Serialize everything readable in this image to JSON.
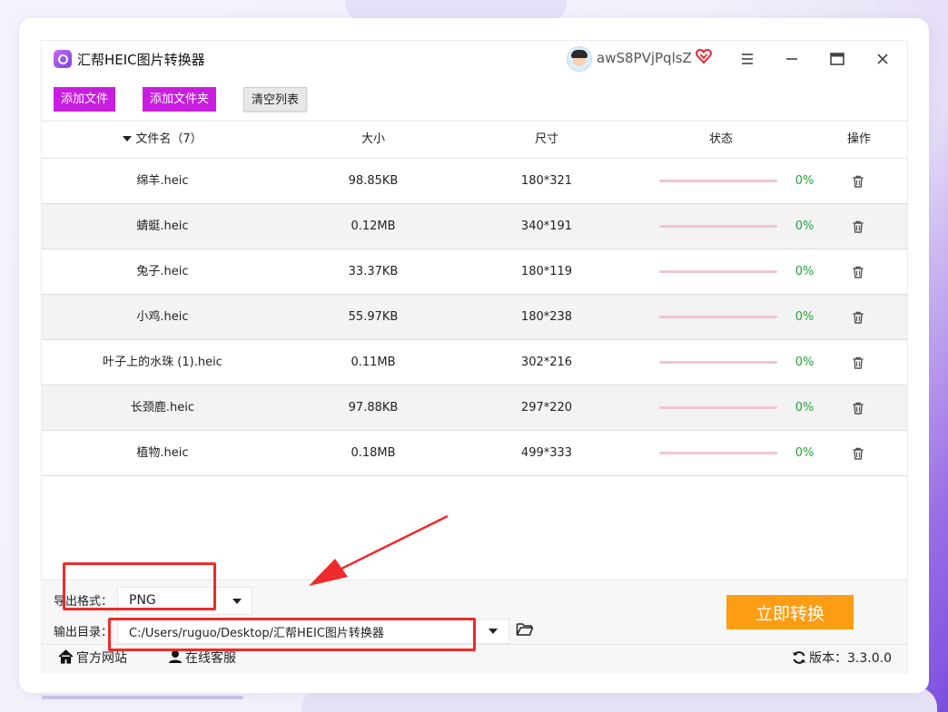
{
  "app": {
    "title": "汇帮HEIC图片转换器",
    "username": "awS8PVjPqlsZ"
  },
  "toolbar": {
    "add_file": "添加文件",
    "add_folder": "添加文件夹",
    "clear_list": "清空列表"
  },
  "table": {
    "headers": {
      "filename": "文件名（7）",
      "size": "大小",
      "dimensions": "尺寸",
      "status": "状态",
      "action": "操作"
    },
    "rows": [
      {
        "name": "绵羊.heic",
        "size": "98.85KB",
        "dimensions": "180*321",
        "progress": 0,
        "progress_text": "0%"
      },
      {
        "name": "蜻蜓.heic",
        "size": "0.12MB",
        "dimensions": "340*191",
        "progress": 0,
        "progress_text": "0%"
      },
      {
        "name": "兔子.heic",
        "size": "33.37KB",
        "dimensions": "180*119",
        "progress": 0,
        "progress_text": "0%"
      },
      {
        "name": "小鸡.heic",
        "size": "55.97KB",
        "dimensions": "180*238",
        "progress": 0,
        "progress_text": "0%"
      },
      {
        "name": "叶子上的水珠 (1).heic",
        "size": "0.11MB",
        "dimensions": "302*216",
        "progress": 0,
        "progress_text": "0%"
      },
      {
        "name": "长颈鹿.heic",
        "size": "97.88KB",
        "dimensions": "297*220",
        "progress": 0,
        "progress_text": "0%"
      },
      {
        "name": "植物.heic",
        "size": "0.18MB",
        "dimensions": "499*333",
        "progress": 0,
        "progress_text": "0%"
      }
    ]
  },
  "output": {
    "format_label": "导出格式：",
    "format_value": "PNG",
    "dir_label": "输出目录：",
    "dir_value": "C:/Users/ruguo/Desktop/汇帮HEIC图片转换器"
  },
  "convert_button": "立即转换",
  "footer": {
    "website": "官方网站",
    "support": "在线客服",
    "version": "版本：3.3.0.0"
  },
  "colors": {
    "accent_purple": "#c81ee0",
    "convert_orange": "#fc9d13",
    "annotation_red": "#ee2a2a",
    "progress_green": "#1fa33a"
  },
  "icons": [
    "app-logo-icon",
    "avatar-icon",
    "vip-heart-icon",
    "menu-icon",
    "minimize-icon",
    "maximize-icon",
    "close-icon",
    "trash-icon",
    "folder-open-icon",
    "home-icon",
    "user-icon",
    "refresh-icon"
  ]
}
